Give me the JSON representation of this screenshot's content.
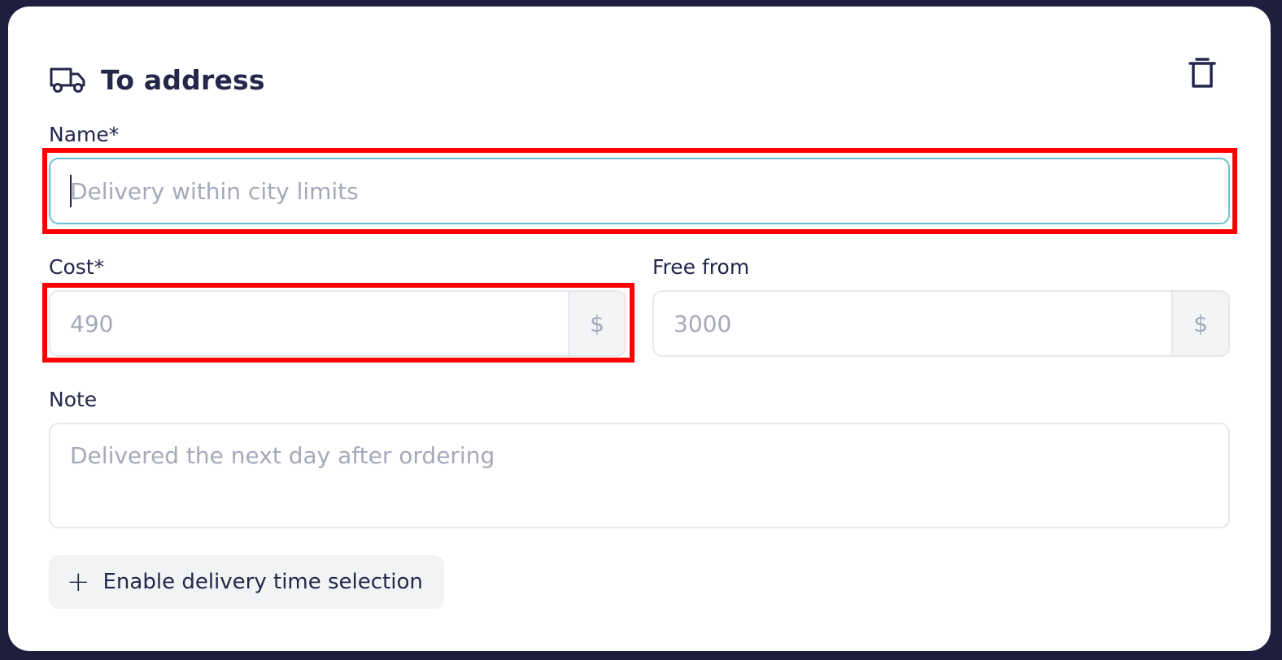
{
  "header": {
    "title": "To address",
    "icon": "truck-icon",
    "delete_icon": "trash-icon"
  },
  "fields": {
    "name": {
      "label": "Name*",
      "placeholder": "Delivery within city limits",
      "value": ""
    },
    "cost": {
      "label": "Cost*",
      "placeholder": "490",
      "suffix": "$"
    },
    "free_from": {
      "label": "Free from",
      "placeholder": "3000",
      "suffix": "$"
    },
    "note": {
      "label": "Note",
      "placeholder": "Delivered the next day after ordering"
    }
  },
  "actions": {
    "enable_time_label": "Enable delivery time selection",
    "enable_time_icon": "plus-icon"
  },
  "colors": {
    "background": "#1f1f3d",
    "card": "#ffffff",
    "text": "#25274a",
    "placeholder": "#a6a9b8",
    "focus_border": "#6cc0d4",
    "highlight": "#ff0000"
  }
}
